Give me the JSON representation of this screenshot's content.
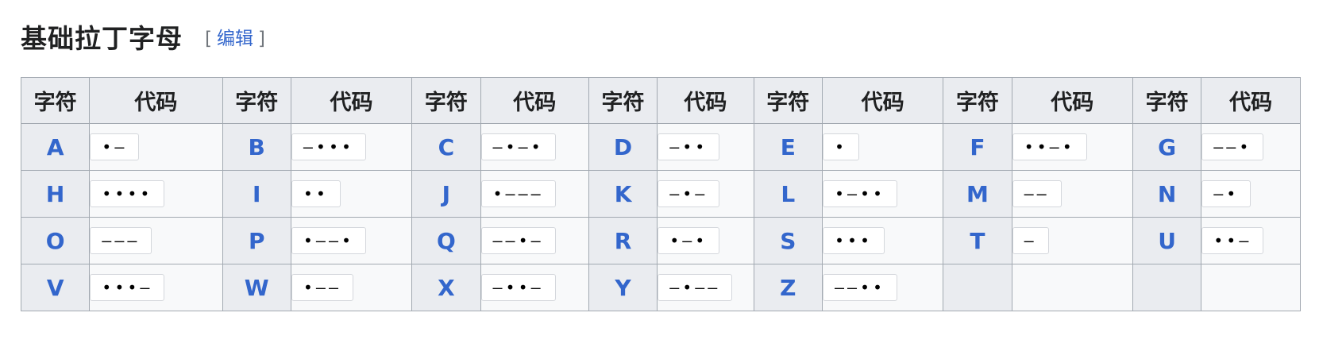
{
  "heading": {
    "title": "基础拉丁字母",
    "edit_open": "[",
    "edit_label": "编辑",
    "edit_close": "]"
  },
  "table": {
    "headers": [
      "字符",
      "代码",
      "字符",
      "代码",
      "字符",
      "代码",
      "字符",
      "代码",
      "字符",
      "代码",
      "字符",
      "代码",
      "字符",
      "代码"
    ],
    "rows": [
      [
        {
          "char": "A",
          "code": "•–"
        },
        {
          "char": "B",
          "code": "–•••"
        },
        {
          "char": "C",
          "code": "–•–•"
        },
        {
          "char": "D",
          "code": "–••"
        },
        {
          "char": "E",
          "code": "•"
        },
        {
          "char": "F",
          "code": "••–•"
        },
        {
          "char": "G",
          "code": "––•"
        }
      ],
      [
        {
          "char": "H",
          "code": "••••"
        },
        {
          "char": "I",
          "code": "••"
        },
        {
          "char": "J",
          "code": "•–––"
        },
        {
          "char": "K",
          "code": "–•–"
        },
        {
          "char": "L",
          "code": "•–••"
        },
        {
          "char": "M",
          "code": "––"
        },
        {
          "char": "N",
          "code": "–•"
        }
      ],
      [
        {
          "char": "O",
          "code": "–––"
        },
        {
          "char": "P",
          "code": "•––•"
        },
        {
          "char": "Q",
          "code": "––•–"
        },
        {
          "char": "R",
          "code": "•–•"
        },
        {
          "char": "S",
          "code": "•••"
        },
        {
          "char": "T",
          "code": "–"
        },
        {
          "char": "U",
          "code": "••–"
        }
      ],
      [
        {
          "char": "V",
          "code": "•••–"
        },
        {
          "char": "W",
          "code": "•––"
        },
        {
          "char": "X",
          "code": "–••–"
        },
        {
          "char": "Y",
          "code": "–•––"
        },
        {
          "char": "Z",
          "code": "––••"
        },
        {
          "char": "",
          "code": ""
        },
        {
          "char": "",
          "code": ""
        }
      ]
    ]
  },
  "colors": {
    "link": "#3366cc",
    "header_bg": "#eaecf0",
    "cell_bg": "#f8f9fa",
    "border": "#a2a9b1"
  }
}
